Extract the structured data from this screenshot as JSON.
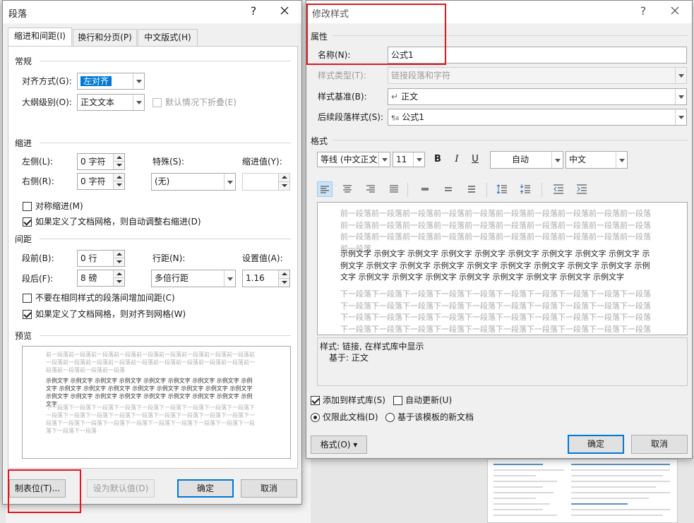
{
  "paragraph_dialog": {
    "title": "段落",
    "help": "?",
    "tabs": [
      "缩进和间距(I)",
      "换行和分页(P)",
      "中文版式(H)"
    ],
    "sections": {
      "general": "常规",
      "indent": "缩进",
      "spacing": "间距",
      "preview": "预览"
    },
    "alignment_label": "对齐方式(G):",
    "alignment_value": "左对齐",
    "outline_label": "大纲级别(O):",
    "outline_value": "正文文本",
    "collapse_label": "默认情况下折叠(E)",
    "left_label": "左侧(L):",
    "left_value": "0 字符",
    "right_label": "右侧(R):",
    "right_value": "0 字符",
    "special_label": "特殊(S):",
    "special_value": "(无)",
    "indent_by_label": "缩进值(Y):",
    "indent_by_value": "",
    "mirror_label": "对称缩进(M)",
    "auto_right_label": "如果定义了文档网格，则自动调整右缩进(D)",
    "before_label": "段前(B):",
    "before_value": "0 行",
    "after_label": "段后(F):",
    "after_value": "8 磅",
    "line_spacing_label": "行距(N):",
    "line_spacing_value": "多倍行距",
    "at_label": "设置值(A):",
    "at_value": "1.16",
    "no_space_label": "不要在相同样式的段落间增加间距(C)",
    "snap_grid_label": "如果定义了文档网格，则对齐到网格(W)",
    "preview_prev": "前一段落前一段落前一段落前一段落前一段落前一段落前一段落前一段落前一段落前一段落前一段落前一段落前一段落前一段落前一段落前一段落前一段落前一段落前一段落前一段落前一段落前一段落",
    "preview_sample": "示例文字 示例文字 示例文字 示例文字 示例文字 示例文字 示例文字 示例文字 示例文字 示例文字 示例文字 示例文字 示例文字 示例文字 示例文字 示例文字 示例文字 示例文字 示例文字 示例文字 示例文字 示例文字 示例文字 示例文字 示例文字 示例文字",
    "preview_next": "下一段落下一段落下一段落下一段落下一段落下一段落下一段落下一段落下一段落下一段落下一段落下一段落下一段落下一段落下一段落下一段落下一段落下一段落下一段落下一段落下一段落下一段落下一段落下一段落下一段落下一段落下一段落下一段落下一段落下一段落",
    "tabs_button": "制表位(T)...",
    "default_button": "设为默认值(D)",
    "ok_button": "确定",
    "cancel_button": "取消"
  },
  "modify_dialog": {
    "title": "修改样式",
    "help": "?",
    "properties_section": "属性",
    "name_label": "名称(N):",
    "name_value": "公式1",
    "type_label": "样式类型(T):",
    "type_value": "链接段落和字符",
    "based_label": "样式基准(B):",
    "based_icon": "↵",
    "based_value": "正文",
    "following_label": "后续段落样式(S):",
    "following_icon": "¶a",
    "following_value": "公式1",
    "format_section": "格式",
    "font_value": "等线 (中文正文)",
    "size_value": "11",
    "bold": "B",
    "italic": "I",
    "underline": "U",
    "color_value": "自动",
    "script_value": "中文",
    "preview_prev": "前一段落前一段落前一段落前一段落前一段落前一段落前一段落前一段落前一段落前一段落前一段落前一段落前一段落前一段落前一段落前一段落前一段落前一段落前一段落前一段落前一段落前一段落前一段落前一段落前一段落前一段落前一段落前一段落前一段落前一段落前一段落",
    "preview_sample": "示例文字 示例文字 示例文字 示例文字 示例文字 示例文字 示例文字 示例文字 示例文字 示例文字 示例文字 示例文字 示例文字 示例文字 示例文字 示例文字 示例文字 示例文字 示例文字 示例文字 示例文字 示例文字 示例文字 示例文字 示例文字 示例文字 示例文字",
    "preview_next": "下一段落下一段落下一段落下一段落下一段落下一段落下一段落下一段落下一段落下一段落下一段落下一段落下一段落下一段落下一段落下一段落下一段落下一段落下一段落下一段落下一段落下一段落下一段落下一段落下一段落下一段落下一段落下一段落下一段落下一段落下一段落下一段落下一段落下一段落下一段落下一段落下一段落下一段落下一段落下一段落下一段落下一段落下一段落下一段落下一段落下一段落",
    "description_line1": "样式: 链接, 在样式库中显示",
    "description_line2": "基于: 正文",
    "add_gallery_label": "添加到样式库(S)",
    "auto_update_label": "自动更新(U)",
    "only_doc_label": "仅限此文档(D)",
    "new_docs_label": "基于该模板的新文档",
    "format_button": "格式(O) ▾",
    "ok_button": "确定",
    "cancel_button": "取消"
  },
  "colors": {
    "accent": "#0078d7",
    "highlight": "#e0181e"
  }
}
